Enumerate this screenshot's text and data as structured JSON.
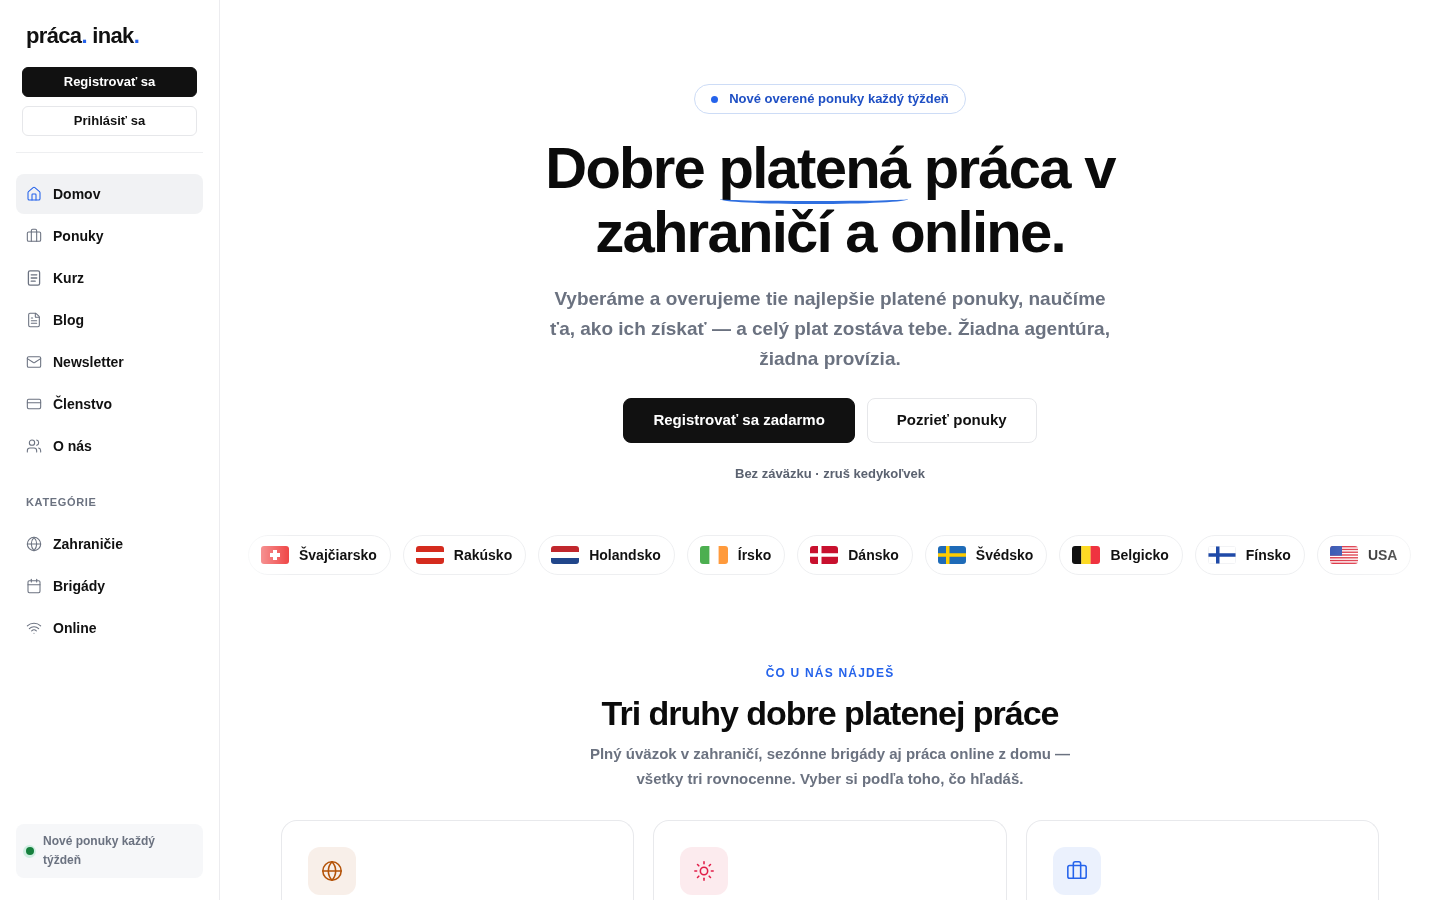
{
  "sidebar": {
    "logo": [
      {
        "text": "práca",
        "accent": false
      },
      {
        "text": ".",
        "accent": true
      },
      {
        "text": " inak",
        "accent": false
      },
      {
        "text": ".",
        "accent": true
      }
    ],
    "buttons": [
      {
        "label": "Registrovať sa",
        "kind": "primary"
      },
      {
        "label": "Prihlásiť sa",
        "kind": "secondary"
      }
    ],
    "nav": [
      {
        "label": "Domov",
        "selected": true
      },
      {
        "label": "Ponuky",
        "selected": false
      },
      {
        "label": "Kurz",
        "selected": false
      },
      {
        "label": "Blog",
        "selected": false
      },
      {
        "label": "Newsletter",
        "selected": false
      },
      {
        "label": "Členstvo",
        "selected": false
      },
      {
        "label": "O nás",
        "selected": false
      }
    ],
    "section_label": "KATEGÓRIE",
    "categories": [
      {
        "label": "Zahraničie",
        "selected": false
      },
      {
        "label": "Brigády",
        "selected": false
      },
      {
        "label": "Online",
        "selected": false
      }
    ],
    "notice": "Nové ponuky každý týždeň"
  },
  "hero": {
    "badge": "Nové overené ponuky každý týždeň",
    "headline": [
      {
        "text": "Dobre ",
        "underlined": false
      },
      {
        "text": "platená",
        "underlined": true
      },
      {
        "text": " práca v zahraničí a online.",
        "underlined": false
      }
    ],
    "subtitle": "Vyberáme a overujeme tie najlepšie platené ponuky, naučíme ťa, ako ich získať — a celý plat zostáva tebe. Žiadna agentúra, žiadna provízia.",
    "buttons": [
      {
        "label": "Registrovať sa zadarmo",
        "kind": "primary"
      },
      {
        "label": "Pozrieť ponuky",
        "kind": "secondary"
      }
    ],
    "note": "Bez záväzku · zruš kedykoľvek"
  },
  "countries": [
    {
      "label": "Švajčiarsko"
    },
    {
      "label": "Rakúsko"
    },
    {
      "label": "Holandsko"
    },
    {
      "label": "Írsko"
    },
    {
      "label": "Dánsko"
    },
    {
      "label": "Švédsko"
    },
    {
      "label": "Belgicko"
    },
    {
      "label": "Fínsko"
    },
    {
      "label": "USA"
    }
  ],
  "features": {
    "eyebrow": "ČO U NÁS NÁJDEŠ",
    "title": "Tri druhy dobre platenej práce",
    "subtitle": "Plný úväzok v zahraničí, sezónne brigády aj práca online z domu — všetky tri rovnocenne. Vyber si podľa toho, čo hľadáš.",
    "cards": [
      {
        "color": "#b45309"
      },
      {
        "color": "#e11d48"
      },
      {
        "color": "#2563eb"
      }
    ]
  }
}
